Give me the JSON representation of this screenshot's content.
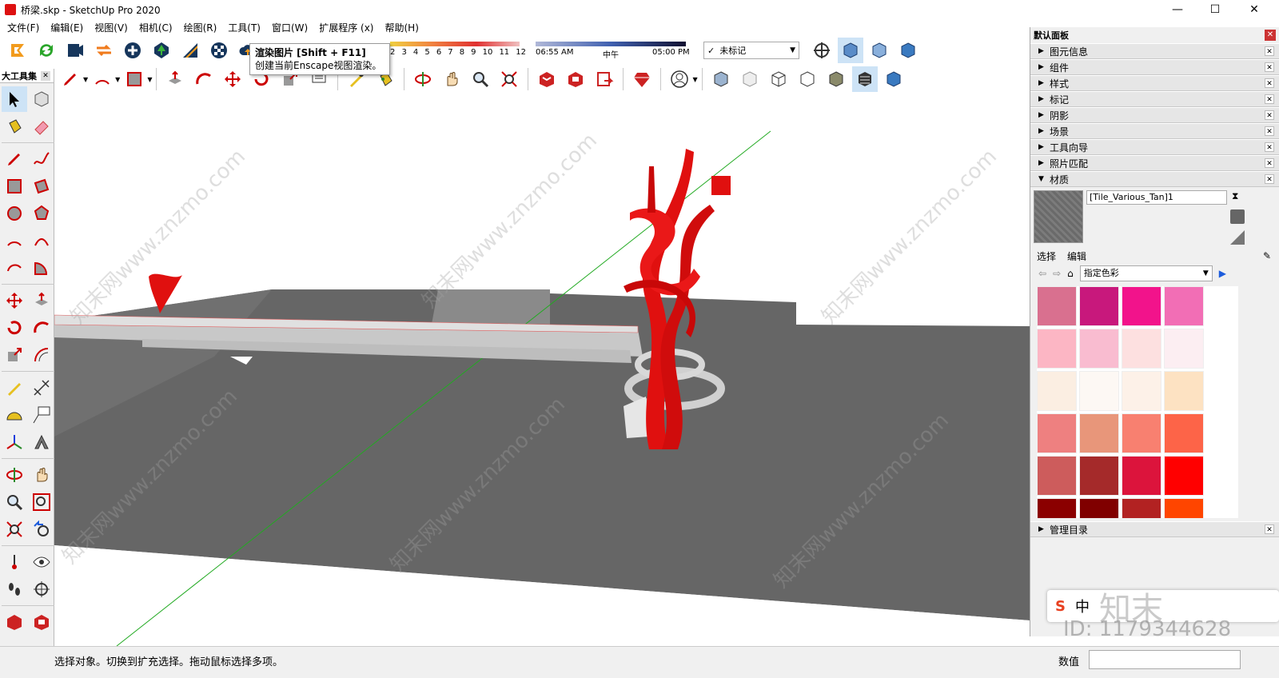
{
  "window": {
    "title": "桥梁.skp - SketchUp Pro 2020",
    "minimize": "—",
    "maximize": "☐",
    "close": "✕"
  },
  "menu": [
    "文件(F)",
    "编辑(E)",
    "视图(V)",
    "相机(C)",
    "绘图(R)",
    "工具(T)",
    "窗口(W)",
    "扩展程序 (x)",
    "帮助(H)"
  ],
  "tooltip": {
    "title": "渲染图片 [Shift + F11]",
    "desc": "创建当前Enscape视图渲染。"
  },
  "shadows": {
    "months": [
      "2",
      "3",
      "4",
      "5",
      "6",
      "7",
      "8",
      "9",
      "10",
      "11",
      "12"
    ],
    "time_start": "06:55 AM",
    "time_mid": "中午",
    "time_end": "05:00 PM"
  },
  "tags": {
    "check": "✓",
    "selected": "未标记"
  },
  "left_toolbar": {
    "title": "大工具集",
    "close": "✕"
  },
  "tray": {
    "title": "默认面板",
    "close": "✕",
    "panels": [
      {
        "label": "图元信息",
        "state": "collapsed"
      },
      {
        "label": "组件",
        "state": "collapsed"
      },
      {
        "label": "样式",
        "state": "collapsed"
      },
      {
        "label": "标记",
        "state": "collapsed"
      },
      {
        "label": "阴影",
        "state": "collapsed"
      },
      {
        "label": "场景",
        "state": "collapsed"
      },
      {
        "label": "工具向导",
        "state": "collapsed"
      },
      {
        "label": "照片匹配",
        "state": "collapsed"
      },
      {
        "label": "材质",
        "state": "expanded"
      }
    ],
    "materials": {
      "name": "[Tile_Various_Tan]1",
      "tab_select": "选择",
      "tab_edit": "编辑",
      "collection": "指定色彩",
      "swatches": [
        "#d9708f",
        "#c8187c",
        "#f2138b",
        "#f26eb5",
        "#fcb6c4",
        "#f9bcd0",
        "#fde0e0",
        "#fceef2",
        "#fbeee2",
        "#fdf8f4",
        "#fdf1e8",
        "#fde2c2",
        "#ee8080",
        "#e8967a",
        "#f88070",
        "#fd6448",
        "#cd5c5c",
        "#a52a2a",
        "#dc143c",
        "#ff0000",
        "#8b0000",
        "#800000",
        "#b22222",
        "#ff4500"
      ]
    },
    "manager": "管理目录",
    "close_small": "✕"
  },
  "status": {
    "hint": "选择对象。切换到扩充选择。拖动鼠标选择多项。",
    "measure_label": "数值",
    "measure_value": ""
  },
  "ime": {
    "lang": "中",
    "sogou": "S"
  },
  "watermark": {
    "text": "知末网www.znzmo.com",
    "id": "ID: 1179344628",
    "logo": "知末"
  },
  "colors": {
    "sculpture": "#e0100f",
    "ground": "#666666",
    "ground_light": "#7d7d7d",
    "axis_green": "#22aa22"
  }
}
